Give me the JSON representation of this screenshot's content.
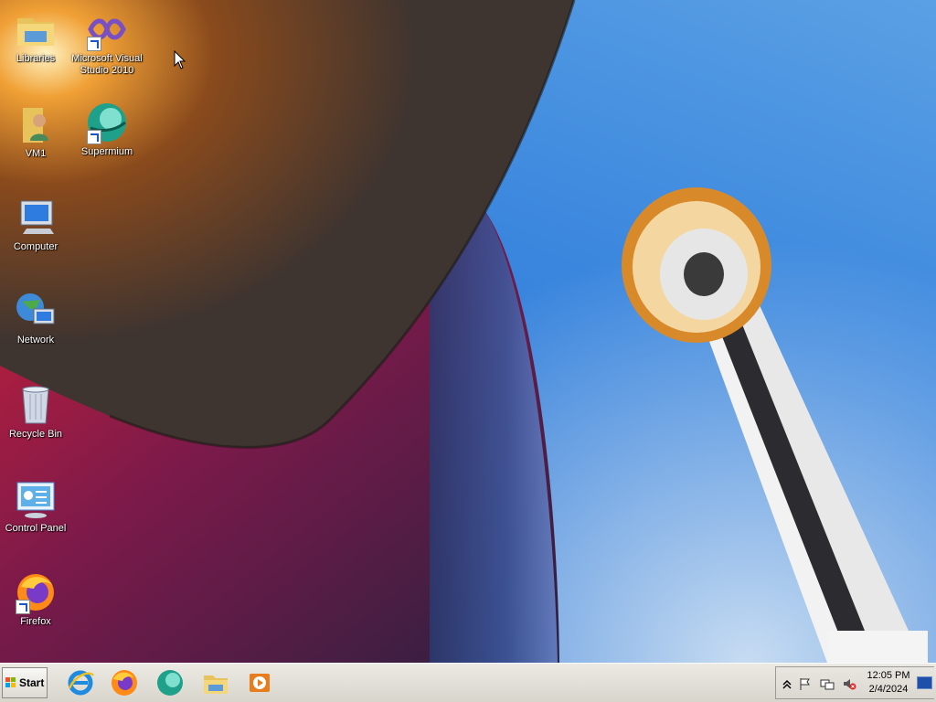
{
  "desktop": {
    "icons": [
      {
        "label": "Libraries",
        "icon": "libraries-folder-icon"
      },
      {
        "label": "Microsoft Visual Studio 2010",
        "icon": "visual-studio-icon"
      },
      {
        "label": "VM1",
        "icon": "user-folder-icon"
      },
      {
        "label": "Supermium",
        "icon": "supermium-icon"
      },
      {
        "label": "Computer",
        "icon": "computer-icon"
      },
      {
        "label": "Network",
        "icon": "network-icon"
      },
      {
        "label": "Recycle Bin",
        "icon": "recycle-bin-icon"
      },
      {
        "label": "Control Panel",
        "icon": "control-panel-icon"
      },
      {
        "label": "Firefox",
        "icon": "firefox-icon"
      }
    ],
    "vs_label_line1": "Microsoft Visual",
    "vs_label_line2": "Studio 2010"
  },
  "taskbar": {
    "start_label": "Start",
    "pinned": [
      {
        "name": "internet-explorer",
        "icon": "internet-explorer-icon"
      },
      {
        "name": "firefox",
        "icon": "firefox-icon"
      },
      {
        "name": "supermium",
        "icon": "supermium-icon"
      },
      {
        "name": "file-explorer",
        "icon": "folder-icon"
      },
      {
        "name": "media-player",
        "icon": "media-player-icon"
      }
    ],
    "tray": {
      "icons": [
        "show-hidden-icons-chevron",
        "action-center-flag-icon",
        "network-icon",
        "volume-muted-icon"
      ],
      "time": "12:05 PM",
      "date": "2/4/2024"
    }
  },
  "colors": {
    "taskbar": "#dcd9d1",
    "sky": "#2f78d8",
    "label_text": "#ffffff"
  }
}
